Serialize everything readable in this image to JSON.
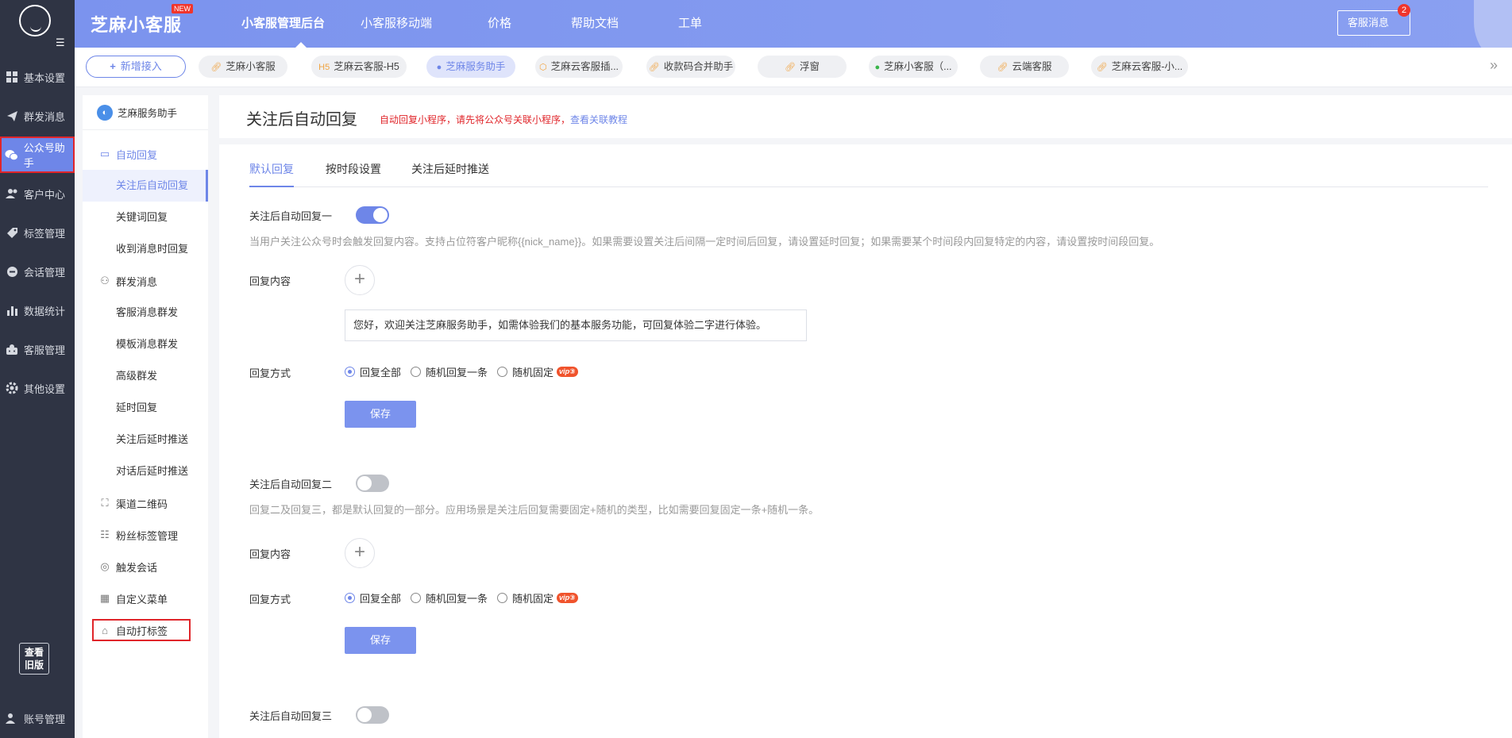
{
  "rail": {
    "items": [
      {
        "label": "基本设置",
        "icon": "grid-icon"
      },
      {
        "label": "群发消息",
        "icon": "send-icon"
      },
      {
        "label": "公众号助手",
        "icon": "wechat-icon"
      },
      {
        "label": "客户中心",
        "icon": "users-icon"
      },
      {
        "label": "标签管理",
        "icon": "tag-icon"
      },
      {
        "label": "会话管理",
        "icon": "chat-icon"
      },
      {
        "label": "数据统计",
        "icon": "chart-icon"
      },
      {
        "label": "客服管理",
        "icon": "agent-icon"
      },
      {
        "label": "其他设置",
        "icon": "gear-icon"
      }
    ],
    "old_version_line1": "查看",
    "old_version_line2": "旧版",
    "account": "账号管理"
  },
  "topbar": {
    "brand": "芝麻小客服",
    "brand_badge": "NEW",
    "nav": [
      "小客服管理后台",
      "小客服移动端",
      "价格",
      "帮助文档",
      "工单"
    ],
    "service_msg": "客服消息",
    "service_badge": "2"
  },
  "tabstrip": {
    "add_label": "新增接入",
    "tabs": [
      {
        "label": "芝麻小客服",
        "icon": "link"
      },
      {
        "label": "芝麻云客服-H5",
        "icon": "h5"
      },
      {
        "label": "芝麻服务助手",
        "icon": "wechat"
      },
      {
        "label": "芝麻云客服插...",
        "icon": "box"
      },
      {
        "label": "收款码合并助手",
        "icon": "link"
      },
      {
        "label": "浮窗",
        "icon": "link"
      },
      {
        "label": "芝麻小客服（...",
        "icon": "wechat-green"
      },
      {
        "label": "云端客服",
        "icon": "link"
      },
      {
        "label": "芝麻云客服-小...",
        "icon": "link"
      }
    ]
  },
  "subside": {
    "head": "芝麻服务助手",
    "auto_reply": "自动回复",
    "auto_reply_items": [
      "关注后自动回复",
      "关键词回复",
      "收到消息时回复"
    ],
    "mass": "群发消息",
    "mass_items": [
      "客服消息群发",
      "模板消息群发",
      "高级群发",
      "延时回复",
      "关注后延时推送",
      "对话后延时推送"
    ],
    "qrcode": "渠道二维码",
    "fans_tag": "粉丝标签管理",
    "trigger": "触发会话",
    "menu": "自定义菜单",
    "auto_tag": "自动打标签"
  },
  "main": {
    "title": "关注后自动回复",
    "note": "自动回复小程序，请先将公众号关联小程序，",
    "note_link": "查看关联教程",
    "tabs": [
      "默认回复",
      "按时段设置",
      "关注后延时推送"
    ],
    "reply1": {
      "label": "关注后自动回复一",
      "hint": "当用户关注公众号时会触发回复内容。支持占位符客户昵称{{nick_name}}。如果需要设置关注后间隔一定时间后回复，请设置延时回复；如果需要某个时间段内回复特定的内容，请设置按时间段回复。",
      "content_label": "回复内容",
      "message": "您好，欢迎关注芝麻服务助手，如需体验我们的基本服务功能，可回复体验二字进行体验。",
      "mode_label": "回复方式",
      "options": [
        "回复全部",
        "随机回复一条",
        "随机固定"
      ],
      "vip": "vip③",
      "save": "保存"
    },
    "reply2": {
      "label": "关注后自动回复二",
      "hint": "回复二及回复三，都是默认回复的一部分。应用场景是关注后回复需要固定+随机的类型，比如需要回复固定一条+随机一条。",
      "content_label": "回复内容",
      "mode_label": "回复方式",
      "options": [
        "回复全部",
        "随机回复一条",
        "随机固定"
      ],
      "vip": "vip③",
      "save": "保存"
    },
    "reply3": {
      "label": "关注后自动回复三"
    }
  }
}
